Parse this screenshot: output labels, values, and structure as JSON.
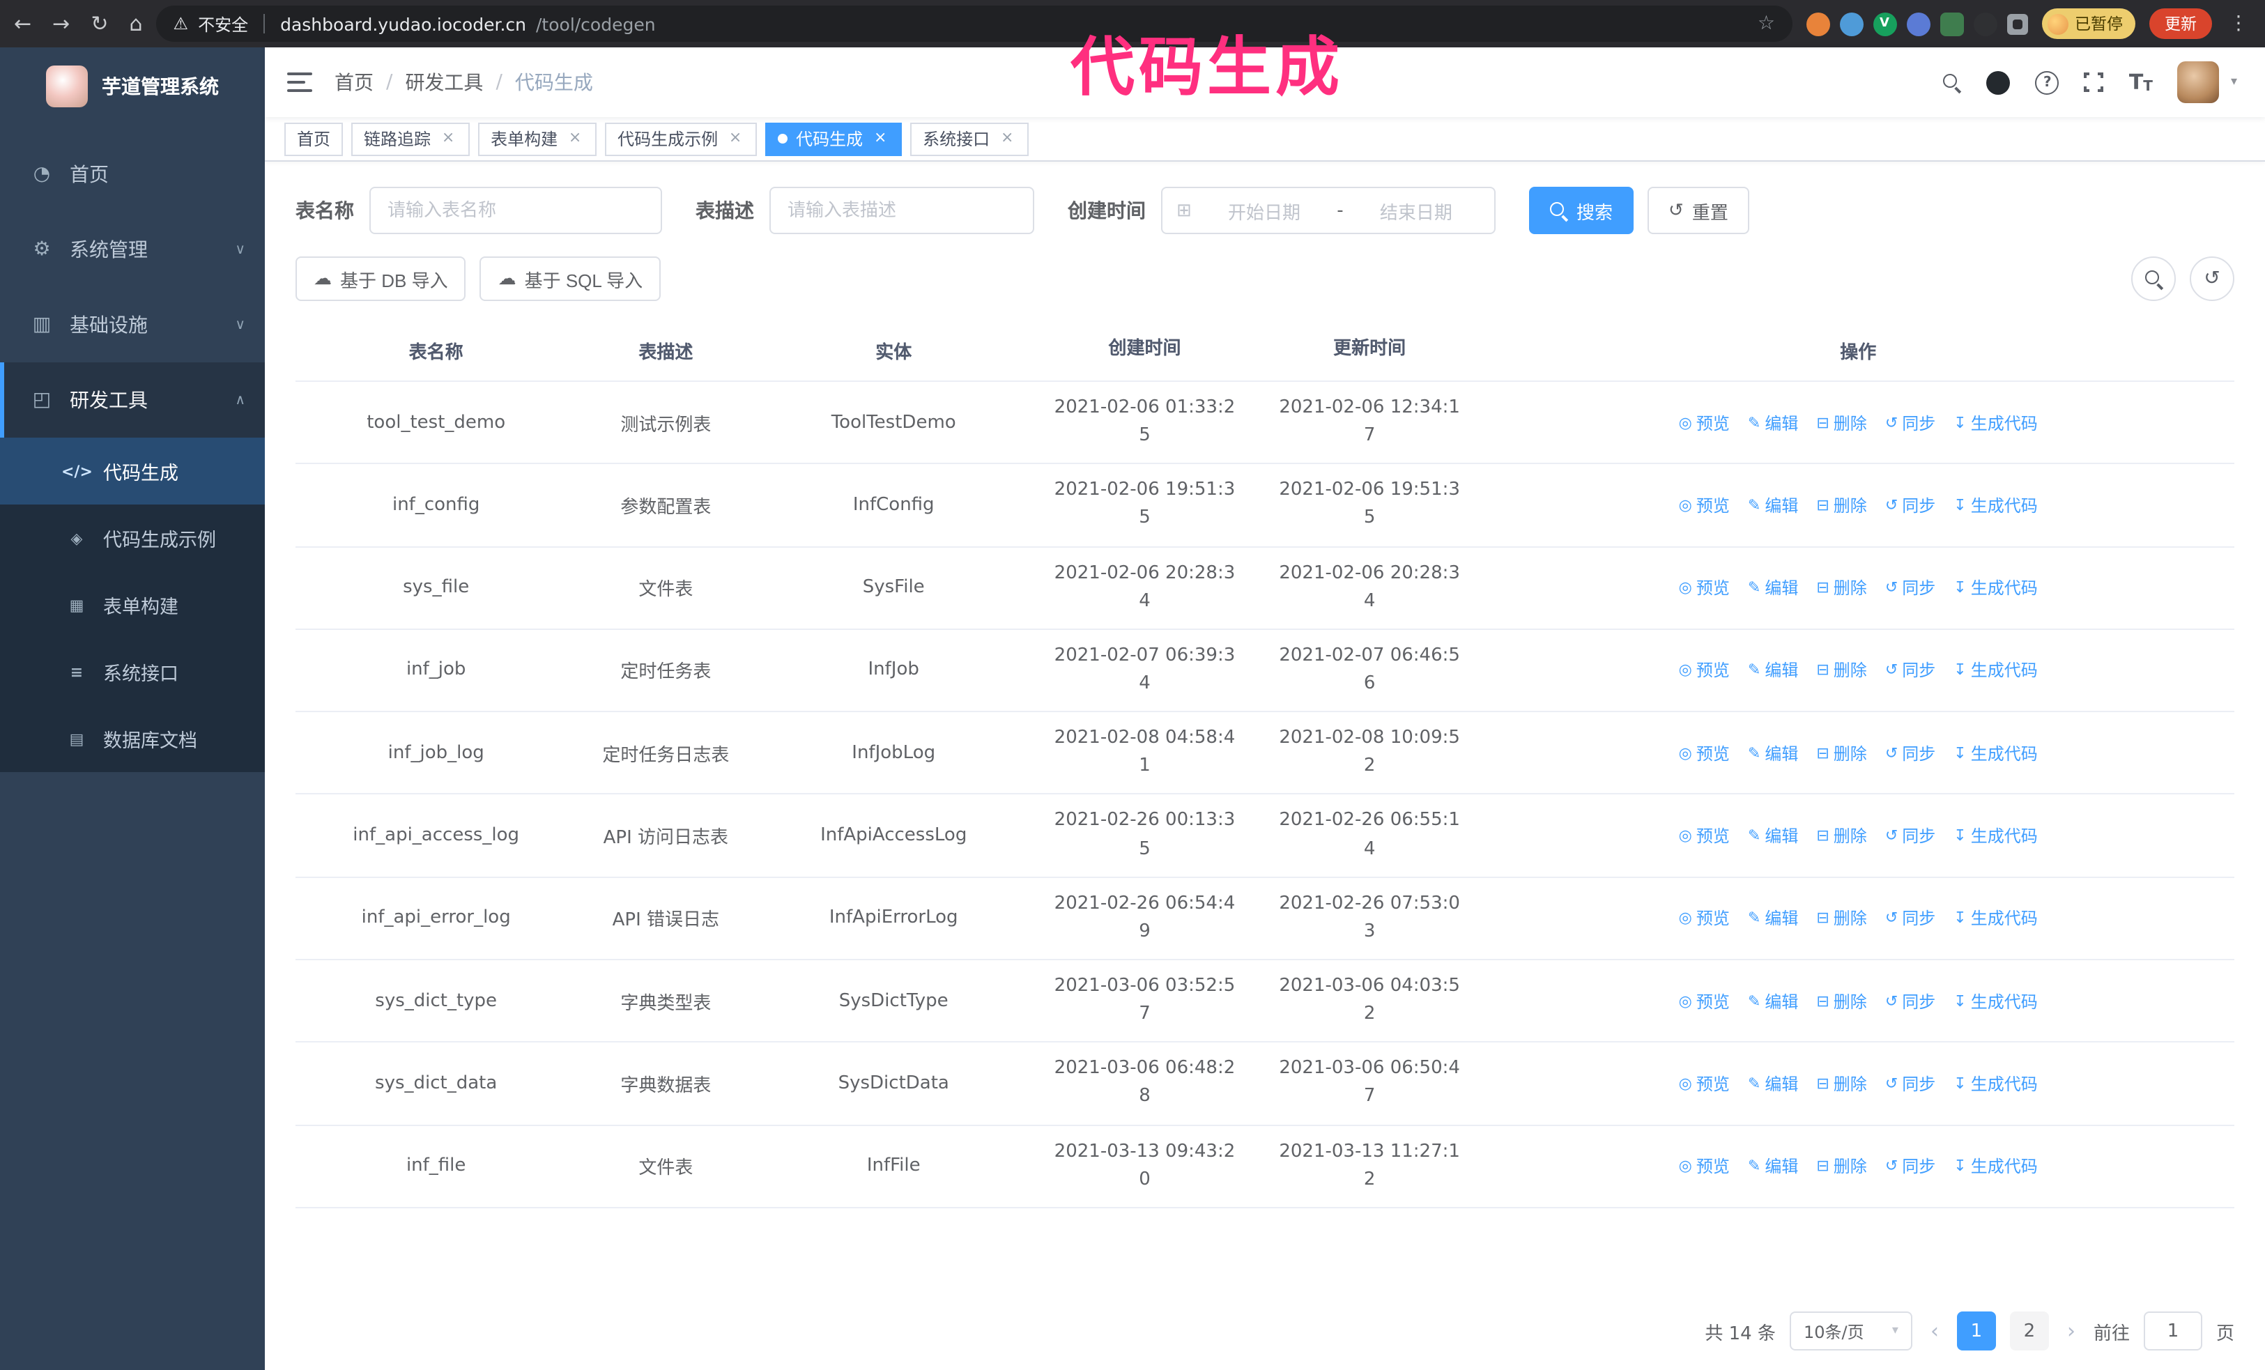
{
  "colors": {
    "accent": "#409eff",
    "annotation_pink": "#ff2f7f",
    "sidebar_bg": "#304156",
    "submenu_bg": "#1f2d3d",
    "update_button_red": "#d9442c",
    "active_tab_blue": "#409eff"
  },
  "annotation": {
    "text": "代码生成"
  },
  "browser": {
    "security_warning": "不安全",
    "url_host": "dashboard.yudao.iocoder.cn",
    "url_path": "/tool/codegen",
    "paused_badge": "已暂停",
    "update_button": "更新"
  },
  "icons": {
    "back": "←",
    "forward": "→",
    "reload": "↻",
    "home": "⌂",
    "warning": "⚠",
    "star": "☆",
    "dots": "⋮",
    "close": "×",
    "caret_down": "▾",
    "chevron_down": "∨",
    "chevron_up": "∧",
    "menu_home": "◔",
    "menu_system": "⚙",
    "menu_infra": "▥",
    "menu_dev": "◰",
    "menu_codegen": "</>",
    "menu_demo": "◈",
    "menu_form": "▦",
    "menu_api": "≡",
    "menu_db": "▤",
    "calendar": "⊞",
    "reset": "↺",
    "upload": "☁",
    "eye": "◎",
    "pencil": "✎",
    "trash": "⊟",
    "sync": "↺",
    "download": "↧",
    "prev": "‹",
    "next": "›",
    "question": "?",
    "font_size_large": "T",
    "font_size_small": "T",
    "ext_v": "V"
  },
  "sidebar": {
    "logo_title": "芋道管理系统",
    "items": [
      {
        "label": "首页"
      },
      {
        "label": "系统管理"
      },
      {
        "label": "基础设施"
      },
      {
        "label": "研发工具"
      }
    ],
    "sub_items": [
      {
        "label": "代码生成",
        "active": true
      },
      {
        "label": "代码生成示例"
      },
      {
        "label": "表单构建"
      },
      {
        "label": "系统接口"
      },
      {
        "label": "数据库文档"
      }
    ]
  },
  "header": {
    "breadcrumb": [
      "首页",
      "研发工具",
      "代码生成"
    ],
    "separator": "/"
  },
  "tabs": [
    {
      "label": "首页"
    },
    {
      "label": "链路追踪"
    },
    {
      "label": "表单构建"
    },
    {
      "label": "代码生成示例"
    },
    {
      "label": "代码生成",
      "active": true
    },
    {
      "label": "系统接口"
    }
  ],
  "filters": {
    "table_name_label": "表名称",
    "table_name_placeholder": "请输入表名称",
    "table_desc_label": "表描述",
    "table_desc_placeholder": "请输入表描述",
    "create_time_label": "创建时间",
    "date_start_placeholder": "开始日期",
    "date_separator": "-",
    "date_end_placeholder": "结束日期",
    "search_button": "搜索",
    "reset_button": "重置"
  },
  "toolbar": {
    "import_db": "基于 DB 导入",
    "import_sql": "基于 SQL 导入"
  },
  "table": {
    "columns": [
      "表名称",
      "表描述",
      "实体",
      "创建时间",
      "更新时间",
      "操作"
    ],
    "actions": [
      "预览",
      "编辑",
      "删除",
      "同步",
      "生成代码"
    ],
    "rows": [
      {
        "name": "tool_test_demo",
        "desc": "测试示例表",
        "entity": "ToolTestDemo",
        "created": "2021-02-06 01:33:25",
        "updated": "2021-02-06 12:34:17"
      },
      {
        "name": "inf_config",
        "desc": "参数配置表",
        "entity": "InfConfig",
        "created": "2021-02-06 19:51:35",
        "updated": "2021-02-06 19:51:35"
      },
      {
        "name": "sys_file",
        "desc": "文件表",
        "entity": "SysFile",
        "created": "2021-02-06 20:28:34",
        "updated": "2021-02-06 20:28:34"
      },
      {
        "name": "inf_job",
        "desc": "定时任务表",
        "entity": "InfJob",
        "created": "2021-02-07 06:39:34",
        "updated": "2021-02-07 06:46:56"
      },
      {
        "name": "inf_job_log",
        "desc": "定时任务日志表",
        "entity": "InfJobLog",
        "created": "2021-02-08 04:58:41",
        "updated": "2021-02-08 10:09:52"
      },
      {
        "name": "inf_api_access_log",
        "desc": "API 访问日志表",
        "entity": "InfApiAccessLog",
        "created": "2021-02-26 00:13:35",
        "updated": "2021-02-26 06:55:14"
      },
      {
        "name": "inf_api_error_log",
        "desc": "API 错误日志",
        "entity": "InfApiErrorLog",
        "created": "2021-02-26 06:54:49",
        "updated": "2021-02-26 07:53:03"
      },
      {
        "name": "sys_dict_type",
        "desc": "字典类型表",
        "entity": "SysDictType",
        "created": "2021-03-06 03:52:57",
        "updated": "2021-03-06 04:03:52"
      },
      {
        "name": "sys_dict_data",
        "desc": "字典数据表",
        "entity": "SysDictData",
        "created": "2021-03-06 06:48:28",
        "updated": "2021-03-06 06:50:47"
      },
      {
        "name": "inf_file",
        "desc": "文件表",
        "entity": "InfFile",
        "created": "2021-03-13 09:43:20",
        "updated": "2021-03-13 11:27:12"
      }
    ]
  },
  "pagination": {
    "total": "共 14 条",
    "page_size": "10条/页",
    "pages": [
      "1",
      "2"
    ],
    "current_page": "1",
    "goto_label": "前往",
    "goto_value": "1",
    "goto_suffix": "页"
  }
}
